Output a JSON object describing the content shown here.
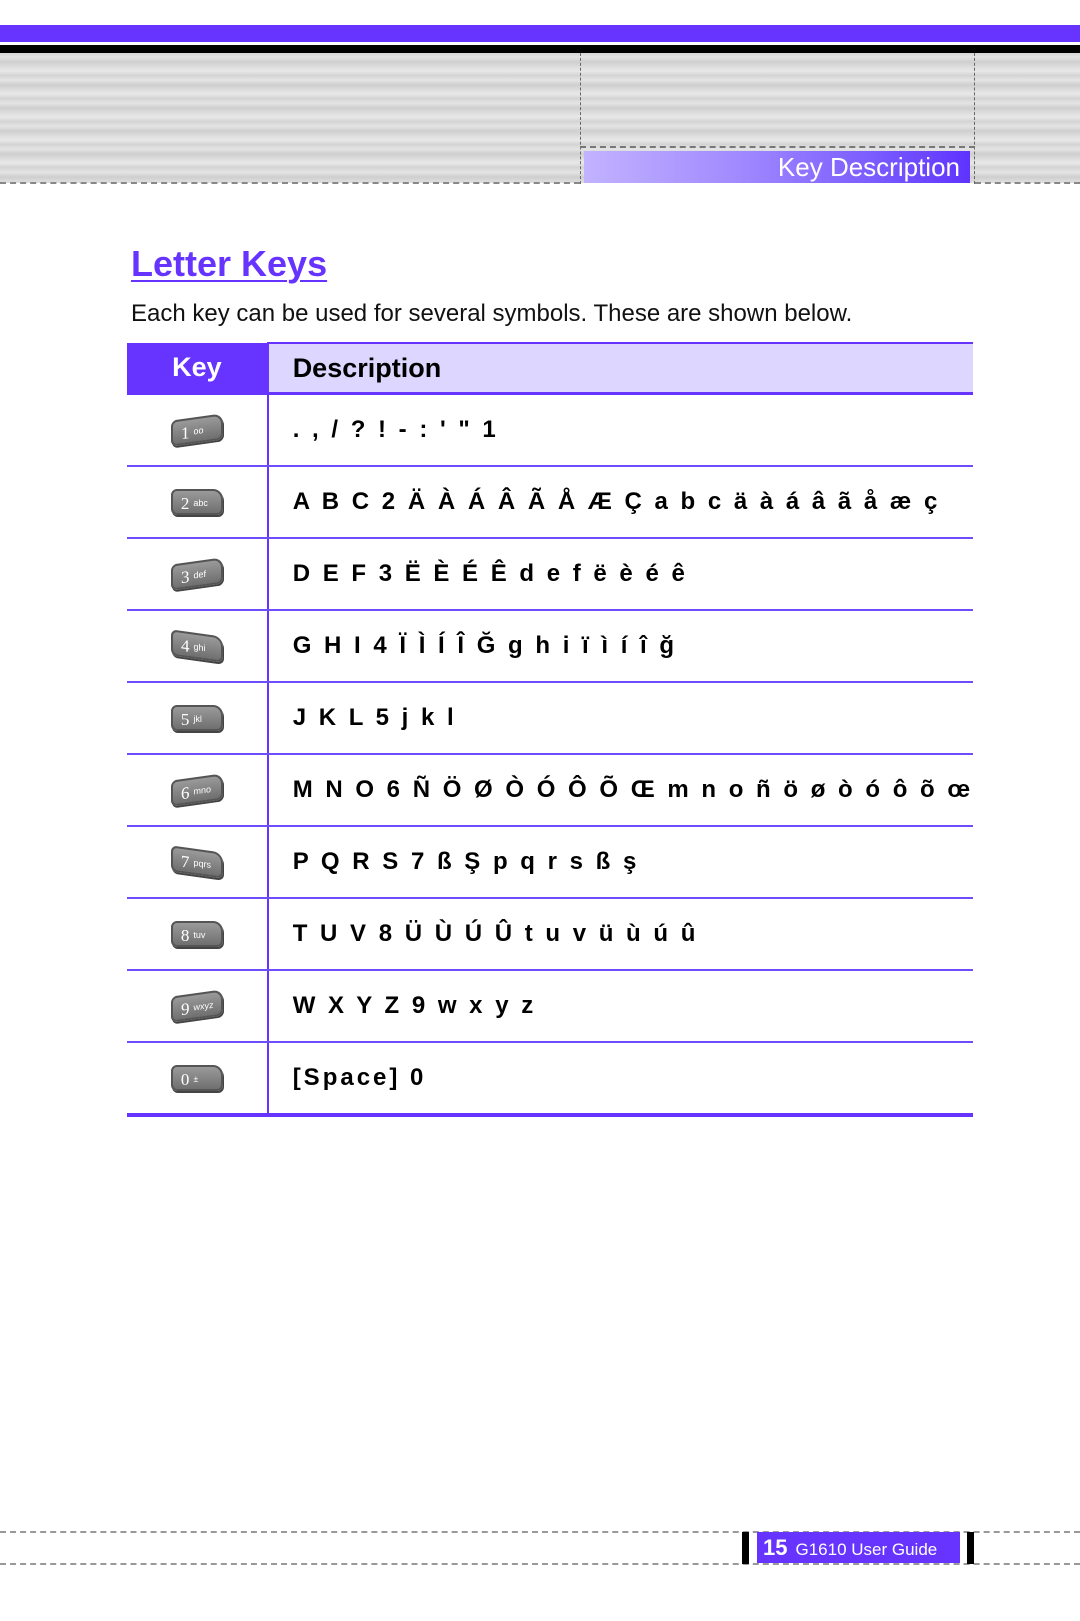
{
  "header": {
    "section_label": "Key Description",
    "colors": {
      "accent": "#6633ff",
      "header_cell_light": "#ddd6ff"
    }
  },
  "page": {
    "title": "Letter Keys",
    "intro": "Each key can be used for several symbols. These are shown below."
  },
  "table": {
    "columns": [
      "Key",
      "Description"
    ],
    "rows": [
      {
        "key_num": "1",
        "key_sub": "oo",
        "key_icon": "key-1-voicemail-icon",
        "description": ". , / ? ! - : ' \" 1"
      },
      {
        "key_num": "2",
        "key_sub": "abc",
        "key_icon": "key-2-abc-icon",
        "description": "A B C 2 Ä À Á Â Ã Å Æ Ç a b c ä à á â ã å æ ç"
      },
      {
        "key_num": "3",
        "key_sub": "def",
        "key_icon": "key-3-def-icon",
        "description": "D E F 3 Ë È É Ê d e f ë è é ê"
      },
      {
        "key_num": "4",
        "key_sub": "ghi",
        "key_icon": "key-4-ghi-icon",
        "description": "G H I 4 Ï Ì Í Î Ğ g h i ï ì í î ğ"
      },
      {
        "key_num": "5",
        "key_sub": "jkl",
        "key_icon": "key-5-jkl-icon",
        "description": "J K L 5 j k l"
      },
      {
        "key_num": "6",
        "key_sub": "mno",
        "key_icon": "key-6-mno-icon",
        "description": "M N O 6 Ñ Ö Ø Ò Ó Ô Õ Œ m n o ñ ö ø ò ó ô õ œ"
      },
      {
        "key_num": "7",
        "key_sub": "pqrs",
        "key_icon": "key-7-pqrs-icon",
        "description": "P Q R S 7 ß Ş p q r s ß ş"
      },
      {
        "key_num": "8",
        "key_sub": "tuv",
        "key_icon": "key-8-tuv-icon",
        "description": "T U V 8 Ü Ù Ú Û t u v ü ù ú û"
      },
      {
        "key_num": "9",
        "key_sub": "wxyz",
        "key_icon": "key-9-wxyz-icon",
        "description": "W X Y Z 9 w x y z"
      },
      {
        "key_num": "0",
        "key_sub": "±",
        "key_icon": "key-0-space-icon",
        "description": "[Space] 0"
      }
    ]
  },
  "footer": {
    "page_number": "15",
    "guide_label": "G1610 User Guide"
  }
}
